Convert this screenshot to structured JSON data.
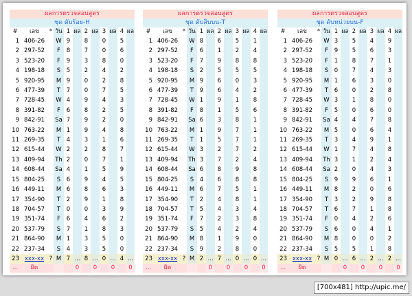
{
  "panels": [
    {
      "title": "ผลการตรวจสอบสูตร",
      "subtitle": "ชุด ดับร้อย-H",
      "headers": [
        "#",
        "เลข",
        "*",
        "วัน",
        "1",
        "ผล",
        "2",
        "ผล",
        "3",
        "ผล",
        "4",
        "ผล"
      ],
      "rows": [
        [
          "1",
          "406-26",
          "",
          "W",
          "9",
          "",
          "8",
          "",
          "0",
          "",
          "5",
          ""
        ],
        [
          "2",
          "297-52",
          "",
          "F",
          "8",
          "",
          "7",
          "",
          "0",
          "",
          "6",
          ""
        ],
        [
          "3",
          "523-20",
          "",
          "F",
          "9",
          "",
          "3",
          "",
          "8",
          "",
          "0",
          ""
        ],
        [
          "4",
          "198-18",
          "",
          "S",
          "5",
          "",
          "2",
          "",
          "4",
          "",
          "2",
          ""
        ],
        [
          "5",
          "920-95",
          "",
          "M",
          "9",
          "",
          "0",
          "",
          "2",
          "",
          "8",
          ""
        ],
        [
          "6",
          "477-39",
          "",
          "T",
          "7",
          "",
          "0",
          "",
          "7",
          "",
          "5",
          ""
        ],
        [
          "7",
          "728-45",
          "",
          "W",
          "4",
          "",
          "9",
          "",
          "4",
          "",
          "3",
          ""
        ],
        [
          "8",
          "391-82",
          "",
          "F",
          "6",
          "",
          "8",
          "",
          "2",
          "",
          "5",
          ""
        ],
        [
          "9",
          "842-91",
          "",
          "Sa",
          "7",
          "",
          "9",
          "",
          "2",
          "",
          "0",
          ""
        ],
        [
          "10",
          "763-22",
          "",
          "M",
          "1",
          "",
          "9",
          "",
          "4",
          "",
          "8",
          ""
        ],
        [
          "11",
          "269-35",
          "",
          "T",
          "4",
          "",
          "3",
          "",
          "1",
          "",
          "6",
          ""
        ],
        [
          "12",
          "615-44",
          "",
          "W",
          "2",
          "",
          "2",
          "",
          "8",
          "",
          "7",
          ""
        ],
        [
          "13",
          "409-94",
          "",
          "Th",
          "2",
          "",
          "0",
          "",
          "7",
          "",
          "1",
          ""
        ],
        [
          "14",
          "608-44",
          "",
          "Sa",
          "4",
          "",
          "1",
          "",
          "5",
          "",
          "9",
          ""
        ],
        [
          "15",
          "804-25",
          "",
          "S",
          "6",
          "",
          "9",
          "",
          "4",
          "",
          "5",
          ""
        ],
        [
          "16",
          "449-11",
          "",
          "M",
          "6",
          "",
          "8",
          "",
          "6",
          "",
          "3",
          ""
        ],
        [
          "17",
          "354-90",
          "",
          "T",
          "2",
          "",
          "9",
          "",
          "1",
          "",
          "8",
          ""
        ],
        [
          "18",
          "704-57",
          "",
          "T",
          "0",
          "",
          "0",
          "",
          "3",
          "",
          "9",
          ""
        ],
        [
          "19",
          "351-74",
          "",
          "F",
          "6",
          "",
          "4",
          "",
          "6",
          "",
          "2",
          ""
        ],
        [
          "20",
          "537-79",
          "",
          "S",
          "7",
          "",
          "1",
          "",
          "8",
          "",
          "3",
          ""
        ],
        [
          "21",
          "864-90",
          "",
          "M",
          "1",
          "",
          "3",
          "",
          "5",
          "",
          "0",
          ""
        ],
        [
          "22",
          "237-34",
          "",
          "S",
          "4",
          "",
          "3",
          "",
          "5",
          "",
          "0",
          ""
        ]
      ],
      "last_row": [
        "23",
        "xxx-xx",
        "?",
        "M",
        "7",
        "...",
        "8",
        "...",
        "0",
        "...",
        "4",
        "..."
      ],
      "miss_row": [
        "...",
        "ผิด",
        "",
        "",
        "",
        "0",
        "",
        "0",
        "",
        "0",
        "",
        "0"
      ]
    },
    {
      "title": "ผลการตรวจสอบสูตร",
      "subtitle": "ชุด ดับสิบบน-T",
      "headers": [
        "#",
        "เลข",
        "*",
        "วัน",
        "1",
        "ผล",
        "2",
        "ผล",
        "3",
        "ผล",
        "4",
        "ผล"
      ],
      "rows": [
        [
          "1",
          "406-26",
          "",
          "W",
          "8",
          "",
          "6",
          "",
          "5",
          "",
          "1",
          ""
        ],
        [
          "2",
          "297-52",
          "",
          "F",
          "6",
          "",
          "1",
          "",
          "2",
          "",
          "4",
          ""
        ],
        [
          "3",
          "523-20",
          "",
          "F",
          "7",
          "",
          "9",
          "",
          "8",
          "",
          "8",
          ""
        ],
        [
          "4",
          "198-18",
          "",
          "S",
          "2",
          "",
          "5",
          "",
          "5",
          "",
          "5",
          ""
        ],
        [
          "5",
          "920-95",
          "",
          "M",
          "9",
          "",
          "6",
          "",
          "0",
          "",
          "3",
          ""
        ],
        [
          "6",
          "477-39",
          "",
          "T",
          "9",
          "",
          "6",
          "",
          "4",
          "",
          "2",
          ""
        ],
        [
          "7",
          "728-45",
          "",
          "W",
          "1",
          "",
          "9",
          "",
          "1",
          "",
          "8",
          ""
        ],
        [
          "8",
          "391-82",
          "",
          "F",
          "8",
          "",
          "1",
          "",
          "5",
          "",
          "6",
          ""
        ],
        [
          "9",
          "842-91",
          "",
          "Sa",
          "6",
          "",
          "3",
          "",
          "8",
          "",
          "1",
          ""
        ],
        [
          "10",
          "763-22",
          "",
          "M",
          "1",
          "",
          "9",
          "",
          "7",
          "",
          "1",
          ""
        ],
        [
          "11",
          "269-35",
          "",
          "T",
          "1",
          "",
          "5",
          "",
          "7",
          "",
          "1",
          ""
        ],
        [
          "12",
          "615-44",
          "",
          "W",
          "3",
          "",
          "2",
          "",
          "7",
          "",
          "2",
          ""
        ],
        [
          "13",
          "409-94",
          "",
          "Th",
          "3",
          "",
          "7",
          "",
          "2",
          "",
          "4",
          ""
        ],
        [
          "14",
          "608-44",
          "",
          "Sa",
          "6",
          "",
          "8",
          "",
          "9",
          "",
          "8",
          ""
        ],
        [
          "15",
          "804-25",
          "",
          "S",
          "4",
          "",
          "6",
          "",
          "8",
          "",
          "8",
          ""
        ],
        [
          "16",
          "449-11",
          "",
          "M",
          "6",
          "",
          "7",
          "",
          "5",
          "",
          "1",
          ""
        ],
        [
          "17",
          "354-90",
          "",
          "T",
          "2",
          "",
          "4",
          "",
          "8",
          "",
          "1",
          ""
        ],
        [
          "18",
          "704-57",
          "",
          "T",
          "5",
          "",
          "4",
          "",
          "3",
          "",
          "4",
          ""
        ],
        [
          "19",
          "351-74",
          "",
          "F",
          "7",
          "",
          "2",
          "",
          "3",
          "",
          "8",
          ""
        ],
        [
          "20",
          "537-79",
          "",
          "S",
          "5",
          "",
          "4",
          "",
          "2",
          "",
          "4",
          ""
        ],
        [
          "21",
          "864-90",
          "",
          "M",
          "8",
          "",
          "1",
          "",
          "9",
          "",
          "0",
          ""
        ],
        [
          "22",
          "237-34",
          "",
          "S",
          "9",
          "",
          "2",
          "",
          "8",
          "",
          "0",
          ""
        ]
      ],
      "last_row": [
        "23",
        "xxx-xx",
        "?",
        "M",
        "2",
        "...",
        "7",
        "...",
        "0",
        "...",
        "0",
        "..."
      ],
      "miss_row": [
        "...",
        "ผิด",
        "",
        "",
        "",
        "0",
        "",
        "0",
        "",
        "0",
        "",
        "0"
      ]
    },
    {
      "title": "ผลการตรวจสอบสูตร",
      "subtitle": "ชุด ดับหน่วยบน-F",
      "headers": [
        "#",
        "เลข",
        "*",
        "วัน",
        "1",
        "ผล",
        "2",
        "ผล",
        "3",
        "ผล",
        "4",
        "ผล"
      ],
      "rows": [
        [
          "1",
          "406-26",
          "",
          "W",
          "3",
          "",
          "5",
          "",
          "4",
          "",
          "9",
          ""
        ],
        [
          "2",
          "297-52",
          "",
          "F",
          "9",
          "",
          "5",
          "",
          "6",
          "",
          "3",
          ""
        ],
        [
          "3",
          "523-20",
          "",
          "F",
          "1",
          "",
          "8",
          "",
          "7",
          "",
          "1",
          ""
        ],
        [
          "4",
          "198-18",
          "",
          "S",
          "0",
          "",
          "7",
          "",
          "4",
          "",
          "3",
          ""
        ],
        [
          "5",
          "920-95",
          "",
          "M",
          "1",
          "",
          "6",
          "",
          "3",
          "",
          "0",
          ""
        ],
        [
          "6",
          "477-39",
          "",
          "T",
          "6",
          "",
          "0",
          "",
          "2",
          "",
          "8",
          ""
        ],
        [
          "7",
          "728-45",
          "",
          "W",
          "3",
          "",
          "1",
          "",
          "8",
          "",
          "0",
          ""
        ],
        [
          "8",
          "391-82",
          "",
          "F",
          "5",
          "",
          "0",
          "",
          "6",
          "",
          "0",
          ""
        ],
        [
          "9",
          "842-91",
          "",
          "Sa",
          "4",
          "",
          "4",
          "",
          "7",
          "",
          "8",
          ""
        ],
        [
          "10",
          "763-22",
          "",
          "M",
          "5",
          "",
          "0",
          "",
          "6",
          "",
          "4",
          ""
        ],
        [
          "11",
          "269-35",
          "",
          "T",
          "3",
          "",
          "4",
          "",
          "9",
          "",
          "1",
          ""
        ],
        [
          "12",
          "615-44",
          "",
          "W",
          "1",
          "",
          "7",
          "",
          "4",
          "",
          "8",
          ""
        ],
        [
          "13",
          "409-94",
          "",
          "Th",
          "3",
          "",
          "1",
          "",
          "2",
          "",
          "4",
          ""
        ],
        [
          "14",
          "608-44",
          "",
          "Sa",
          "2",
          "",
          "0",
          "",
          "4",
          "",
          "3",
          ""
        ],
        [
          "15",
          "804-25",
          "",
          "S",
          "9",
          "",
          "9",
          "",
          "6",
          "",
          "1",
          ""
        ],
        [
          "16",
          "449-11",
          "",
          "M",
          "8",
          "",
          "2",
          "",
          "0",
          "",
          "6",
          ""
        ],
        [
          "17",
          "354-90",
          "",
          "T",
          "3",
          "",
          "2",
          "",
          "9",
          "",
          "8",
          ""
        ],
        [
          "18",
          "704-57",
          "",
          "T",
          "6",
          "",
          "7",
          "",
          "1",
          "",
          "8",
          ""
        ],
        [
          "19",
          "351-74",
          "",
          "F",
          "0",
          "",
          "4",
          "",
          "2",
          "",
          "6",
          ""
        ],
        [
          "20",
          "537-79",
          "",
          "S",
          "6",
          "",
          "0",
          "",
          "4",
          "",
          "1",
          ""
        ],
        [
          "21",
          "864-90",
          "",
          "M",
          "8",
          "",
          "0",
          "",
          "0",
          "",
          "2",
          ""
        ],
        [
          "22",
          "237-34",
          "",
          "S",
          "5",
          "",
          "5",
          "",
          "1",
          "",
          "8",
          ""
        ]
      ],
      "last_row": [
        "23",
        "xxx-xx",
        "?",
        "M",
        "0",
        "...",
        "6",
        "...",
        "2",
        "...",
        "2",
        "..."
      ],
      "miss_row": [
        "...",
        "ผิด",
        "",
        "",
        "",
        "0",
        "",
        "0",
        "",
        "0",
        "",
        "0"
      ]
    }
  ],
  "footer": "[700x481] http://upic.me/"
}
